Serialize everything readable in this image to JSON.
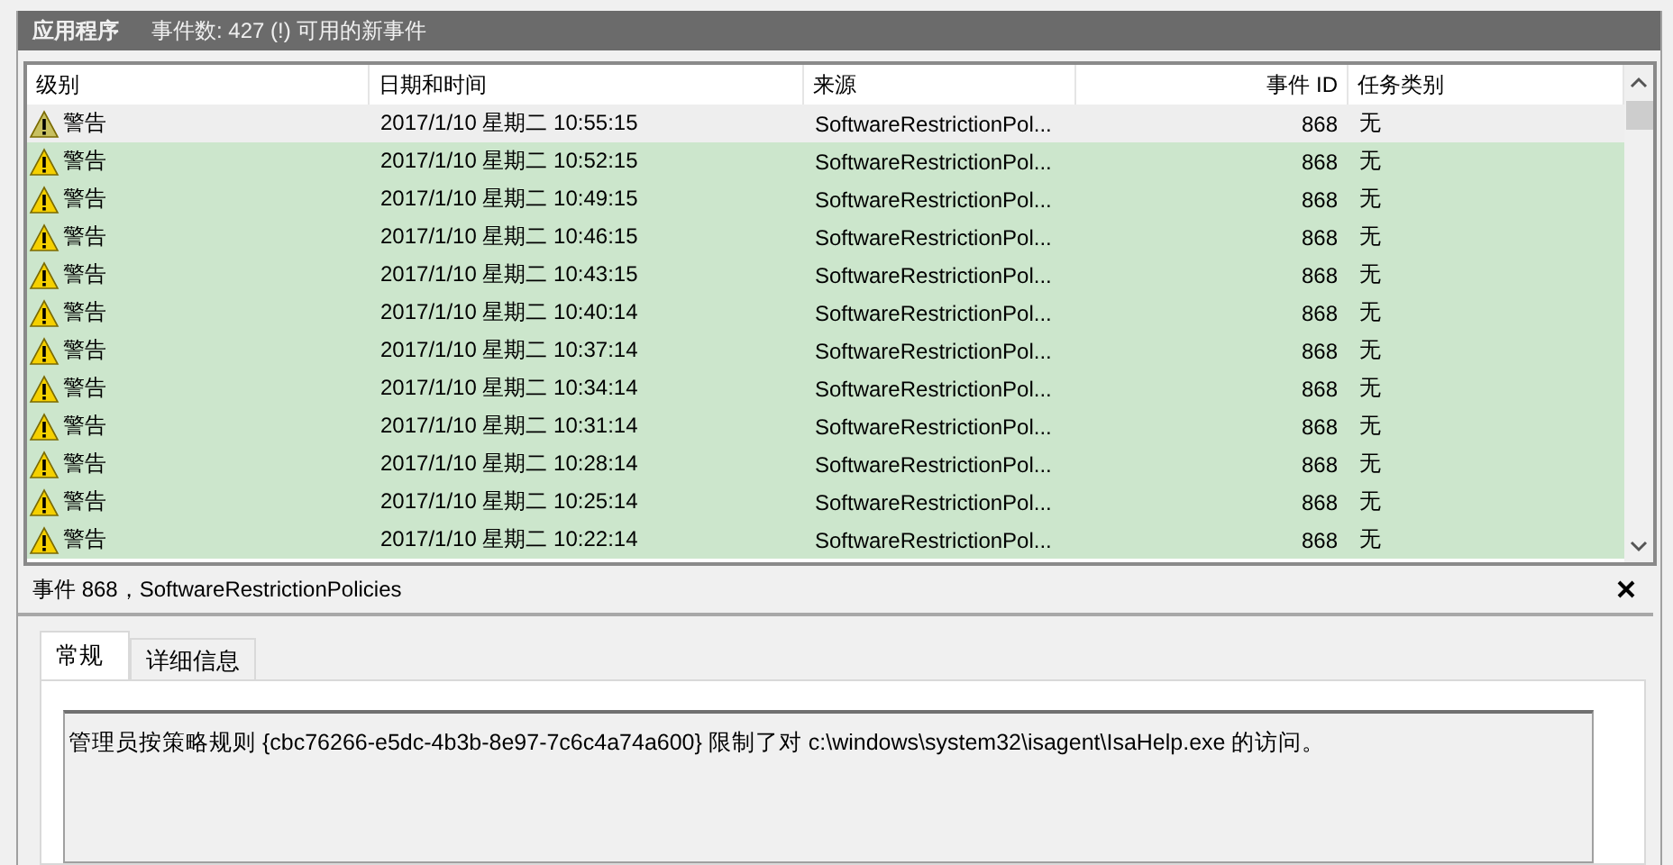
{
  "header": {
    "title": "应用程序",
    "summary": "事件数: 427 (!) 可用的新事件"
  },
  "table": {
    "columns": [
      "级别",
      "日期和时间",
      "来源",
      "事件 ID",
      "任务类别"
    ],
    "rows": [
      {
        "level": "警告",
        "datetime": "2017/1/10 星期二 10:55:15",
        "source": "SoftwareRestrictionPol...",
        "event_id": "868",
        "task": "无",
        "selected": true
      },
      {
        "level": "警告",
        "datetime": "2017/1/10 星期二 10:52:15",
        "source": "SoftwareRestrictionPol...",
        "event_id": "868",
        "task": "无",
        "selected": false
      },
      {
        "level": "警告",
        "datetime": "2017/1/10 星期二 10:49:15",
        "source": "SoftwareRestrictionPol...",
        "event_id": "868",
        "task": "无",
        "selected": false
      },
      {
        "level": "警告",
        "datetime": "2017/1/10 星期二 10:46:15",
        "source": "SoftwareRestrictionPol...",
        "event_id": "868",
        "task": "无",
        "selected": false
      },
      {
        "level": "警告",
        "datetime": "2017/1/10 星期二 10:43:15",
        "source": "SoftwareRestrictionPol...",
        "event_id": "868",
        "task": "无",
        "selected": false
      },
      {
        "level": "警告",
        "datetime": "2017/1/10 星期二 10:40:14",
        "source": "SoftwareRestrictionPol...",
        "event_id": "868",
        "task": "无",
        "selected": false
      },
      {
        "level": "警告",
        "datetime": "2017/1/10 星期二 10:37:14",
        "source": "SoftwareRestrictionPol...",
        "event_id": "868",
        "task": "无",
        "selected": false
      },
      {
        "level": "警告",
        "datetime": "2017/1/10 星期二 10:34:14",
        "source": "SoftwareRestrictionPol...",
        "event_id": "868",
        "task": "无",
        "selected": false
      },
      {
        "level": "警告",
        "datetime": "2017/1/10 星期二 10:31:14",
        "source": "SoftwareRestrictionPol...",
        "event_id": "868",
        "task": "无",
        "selected": false
      },
      {
        "level": "警告",
        "datetime": "2017/1/10 星期二 10:28:14",
        "source": "SoftwareRestrictionPol...",
        "event_id": "868",
        "task": "无",
        "selected": false
      },
      {
        "level": "警告",
        "datetime": "2017/1/10 星期二 10:25:14",
        "source": "SoftwareRestrictionPol...",
        "event_id": "868",
        "task": "无",
        "selected": false
      },
      {
        "level": "警告",
        "datetime": "2017/1/10 星期二 10:22:14",
        "source": "SoftwareRestrictionPol...",
        "event_id": "868",
        "task": "无",
        "selected": false
      }
    ]
  },
  "detail": {
    "title": "事件 868，SoftwareRestrictionPolicies",
    "tabs": [
      {
        "label": "常规",
        "selected": true
      },
      {
        "label": "详细信息",
        "selected": false
      }
    ],
    "message": "管理员按策略规则 {cbc76266-e5dc-4b3b-8e97-7c6c4a74a600} 限制了对 c:\\windows\\system32\\isagent\\IsaHelp.exe 的访问。"
  }
}
